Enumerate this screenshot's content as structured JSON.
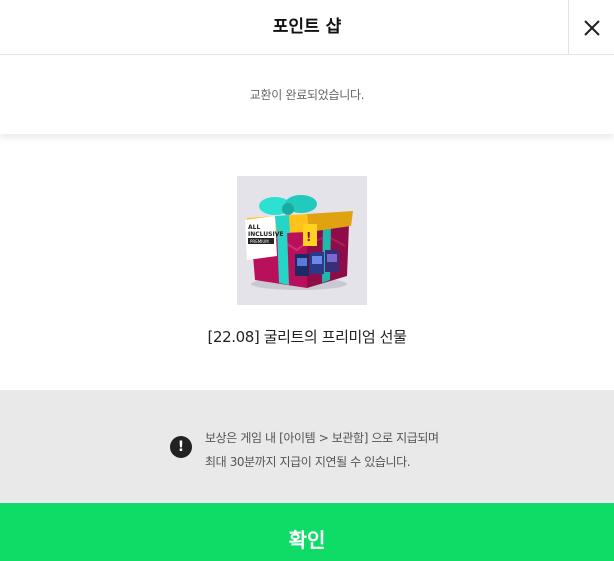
{
  "header": {
    "title": "포인트 샵",
    "close_icon": "close-icon"
  },
  "notice": {
    "message": "교환이 완료되었습니다."
  },
  "reward": {
    "name": "[22.08] 굴리트의 프리미엄 선물",
    "image_icon": "gift-box-image",
    "image_labels": [
      "ALL",
      "INCLUSIVE",
      "PREMIUM"
    ]
  },
  "info": {
    "icon": "exclamation-icon",
    "line1": "보상은 게임 내 [아이템 > 보관함] 으로 지급되며",
    "line2": "최대 30분까지 지급이 지연될 수 있습니다."
  },
  "confirm": {
    "label": "확인"
  },
  "colors": {
    "accent": "#0fdc67",
    "info_bg": "#e9e9e9",
    "thumb_bg": "#e3e3e9"
  }
}
